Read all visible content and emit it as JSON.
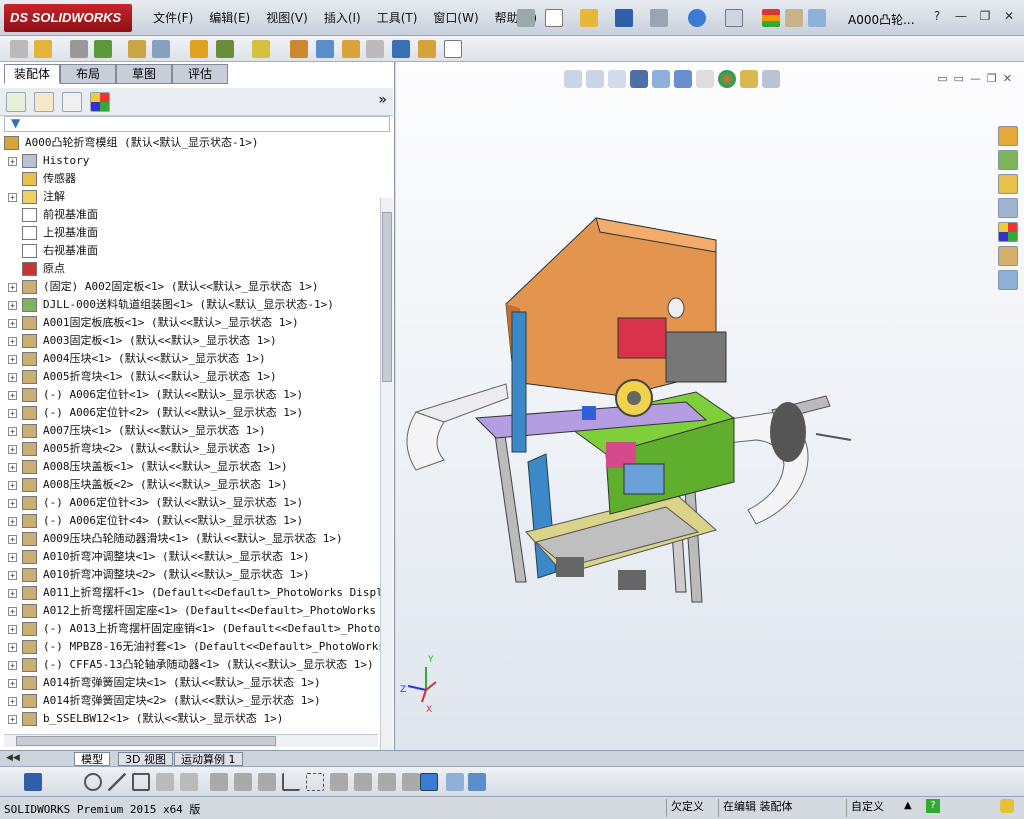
{
  "app": {
    "logo": "DS SOLIDWORKS",
    "doc_title": "A000凸轮..."
  },
  "menu": [
    "文件(F)",
    "编辑(E)",
    "视图(V)",
    "插入(I)",
    "工具(T)",
    "窗口(W)",
    "帮助(H)"
  ],
  "tabs": [
    "装配体",
    "布局",
    "草图",
    "评估"
  ],
  "tree": [
    {
      "label": "A000凸轮折弯模组  (默认<默认_显示状态-1>)",
      "icon": "assembly-icon",
      "exp": false
    },
    {
      "label": "History",
      "icon": "history-icon",
      "exp": true
    },
    {
      "label": "传感器",
      "icon": "sensor-icon",
      "exp": false
    },
    {
      "label": "注解",
      "icon": "annotation-icon",
      "exp": true
    },
    {
      "label": "前视基准面",
      "icon": "plane-icon",
      "exp": false
    },
    {
      "label": "上视基准面",
      "icon": "plane-icon",
      "exp": false
    },
    {
      "label": "右视基准面",
      "icon": "plane-icon",
      "exp": false
    },
    {
      "label": "原点",
      "icon": "origin-icon",
      "exp": false
    },
    {
      "label": "(固定) A002固定板<1> (默认<<默认>_显示状态 1>)",
      "icon": "part-icon",
      "exp": true
    },
    {
      "label": "DJLL-000送料轨道组装图<1> (默认<默认_显示状态-1>)",
      "icon": "subassembly-icon",
      "exp": true
    },
    {
      "label": "A001固定板底板<1> (默认<<默认>_显示状态 1>)",
      "icon": "part-icon",
      "exp": true
    },
    {
      "label": "A003固定板<1> (默认<<默认>_显示状态 1>)",
      "icon": "part-icon",
      "exp": true
    },
    {
      "label": "A004压块<1> (默认<<默认>_显示状态 1>)",
      "icon": "part-icon",
      "exp": true
    },
    {
      "label": "A005折弯块<1> (默认<<默认>_显示状态 1>)",
      "icon": "part-icon",
      "exp": true
    },
    {
      "label": "(-) A006定位针<1> (默认<<默认>_显示状态 1>)",
      "icon": "part-icon",
      "exp": true
    },
    {
      "label": "(-) A006定位针<2> (默认<<默认>_显示状态 1>)",
      "icon": "part-icon",
      "exp": true
    },
    {
      "label": "A007压块<1> (默认<<默认>_显示状态 1>)",
      "icon": "part-icon",
      "exp": true
    },
    {
      "label": "A005折弯块<2> (默认<<默认>_显示状态 1>)",
      "icon": "part-icon",
      "exp": true
    },
    {
      "label": "A008压块盖板<1> (默认<<默认>_显示状态 1>)",
      "icon": "part-icon",
      "exp": true
    },
    {
      "label": "A008压块盖板<2> (默认<<默认>_显示状态 1>)",
      "icon": "part-icon",
      "exp": true
    },
    {
      "label": "(-) A006定位针<3> (默认<<默认>_显示状态 1>)",
      "icon": "part-icon",
      "exp": true
    },
    {
      "label": "(-) A006定位针<4> (默认<<默认>_显示状态 1>)",
      "icon": "part-icon",
      "exp": true
    },
    {
      "label": "A009压块凸轮随动器滑块<1> (默认<<默认>_显示状态 1>)",
      "icon": "part-icon",
      "exp": true
    },
    {
      "label": "A010折弯冲调整块<1> (默认<<默认>_显示状态 1>)",
      "icon": "part-icon",
      "exp": true
    },
    {
      "label": "A010折弯冲调整块<2> (默认<<默认>_显示状态 1>)",
      "icon": "part-icon",
      "exp": true
    },
    {
      "label": "A011上折弯摆杆<1> (Default<<Default>_PhotoWorks Display",
      "icon": "part-icon",
      "exp": true
    },
    {
      "label": "A012上折弯摆杆固定座<1> (Default<<Default>_PhotoWorks Di",
      "icon": "part-icon",
      "exp": true
    },
    {
      "label": "(-) A013上折弯摆杆固定座销<1> (Default<<Default>_PhotoWo",
      "icon": "part-icon",
      "exp": true
    },
    {
      "label": "(-) MPBZ8-16无油衬套<1> (Default<<Default>_PhotoWorks Di",
      "icon": "part-icon",
      "exp": true
    },
    {
      "label": "(-) CFFA5-13凸轮轴承随动器<1> (默认<<默认>_显示状态 1>)",
      "icon": "part-icon",
      "exp": true
    },
    {
      "label": "A014折弯弹簧固定块<1> (默认<<默认>_显示状态 1>)",
      "icon": "part-icon",
      "exp": true
    },
    {
      "label": "A014折弯弹簧固定块<2> (默认<<默认>_显示状态 1>)",
      "icon": "part-icon",
      "exp": true
    },
    {
      "label": "b_SSELBW12<1> (默认<<默认>_显示状态 1>)",
      "icon": "part-icon",
      "exp": true
    }
  ],
  "bottom_tabs": [
    "模型",
    "3D 视图",
    "运动算例 1"
  ],
  "status": {
    "text": "SOLIDWORKS Premium 2015 x64 版",
    "underdefined": "欠定义",
    "editing": "在编辑 装配体",
    "custom": "自定义"
  },
  "triad": {
    "x": "X",
    "y": "Y",
    "z": "Z"
  },
  "colors": {
    "brand": "#b81c22",
    "accent": "#2f6fd0"
  }
}
